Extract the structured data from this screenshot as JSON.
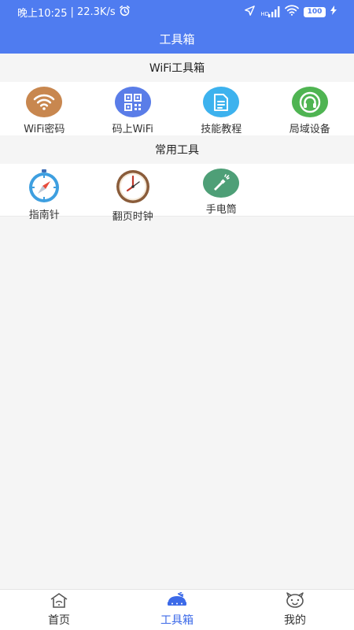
{
  "status_bar": {
    "time": "晚上10:25",
    "network_speed": "| 22.3K/s",
    "hd_label": "HD",
    "battery": "100",
    "icons": [
      "alarm-icon",
      "location-arrow-icon",
      "signal-icon",
      "wifi-icon",
      "battery-icon",
      "charging-icon"
    ]
  },
  "header": {
    "title": "工具箱"
  },
  "sections": [
    {
      "title": "WiFi工具箱",
      "items": [
        {
          "label": "WiFi密码",
          "icon": "wifi-icon",
          "color": "#c8874f"
        },
        {
          "label": "码上WiFi",
          "icon": "qrcode-icon",
          "color": "#5a7de8"
        },
        {
          "label": "技能教程",
          "icon": "document-icon",
          "color": "#3db2ee"
        },
        {
          "label": "局域设备",
          "icon": "headset-icon",
          "color": "#4fb452"
        }
      ]
    },
    {
      "title": "常用工具",
      "items": [
        {
          "label": "指南针",
          "icon": "compass-icon",
          "color": "#3e9fe0"
        },
        {
          "label": "翻页时钟",
          "icon": "clock-icon",
          "color": "#8a5c3a"
        },
        {
          "label": "手电筒",
          "icon": "flashlight-icon",
          "color": "#4e9f77"
        }
      ]
    }
  ],
  "bottom_nav": {
    "active": "工具箱",
    "items": [
      {
        "label": "首页",
        "icon": "home-icon"
      },
      {
        "label": "工具箱",
        "icon": "toolbox-icon"
      },
      {
        "label": "我的",
        "icon": "face-icon"
      }
    ]
  },
  "colors": {
    "primary": "#4f7cf0",
    "active_nav": "#3c6ae8",
    "background": "#f5f5f5"
  }
}
